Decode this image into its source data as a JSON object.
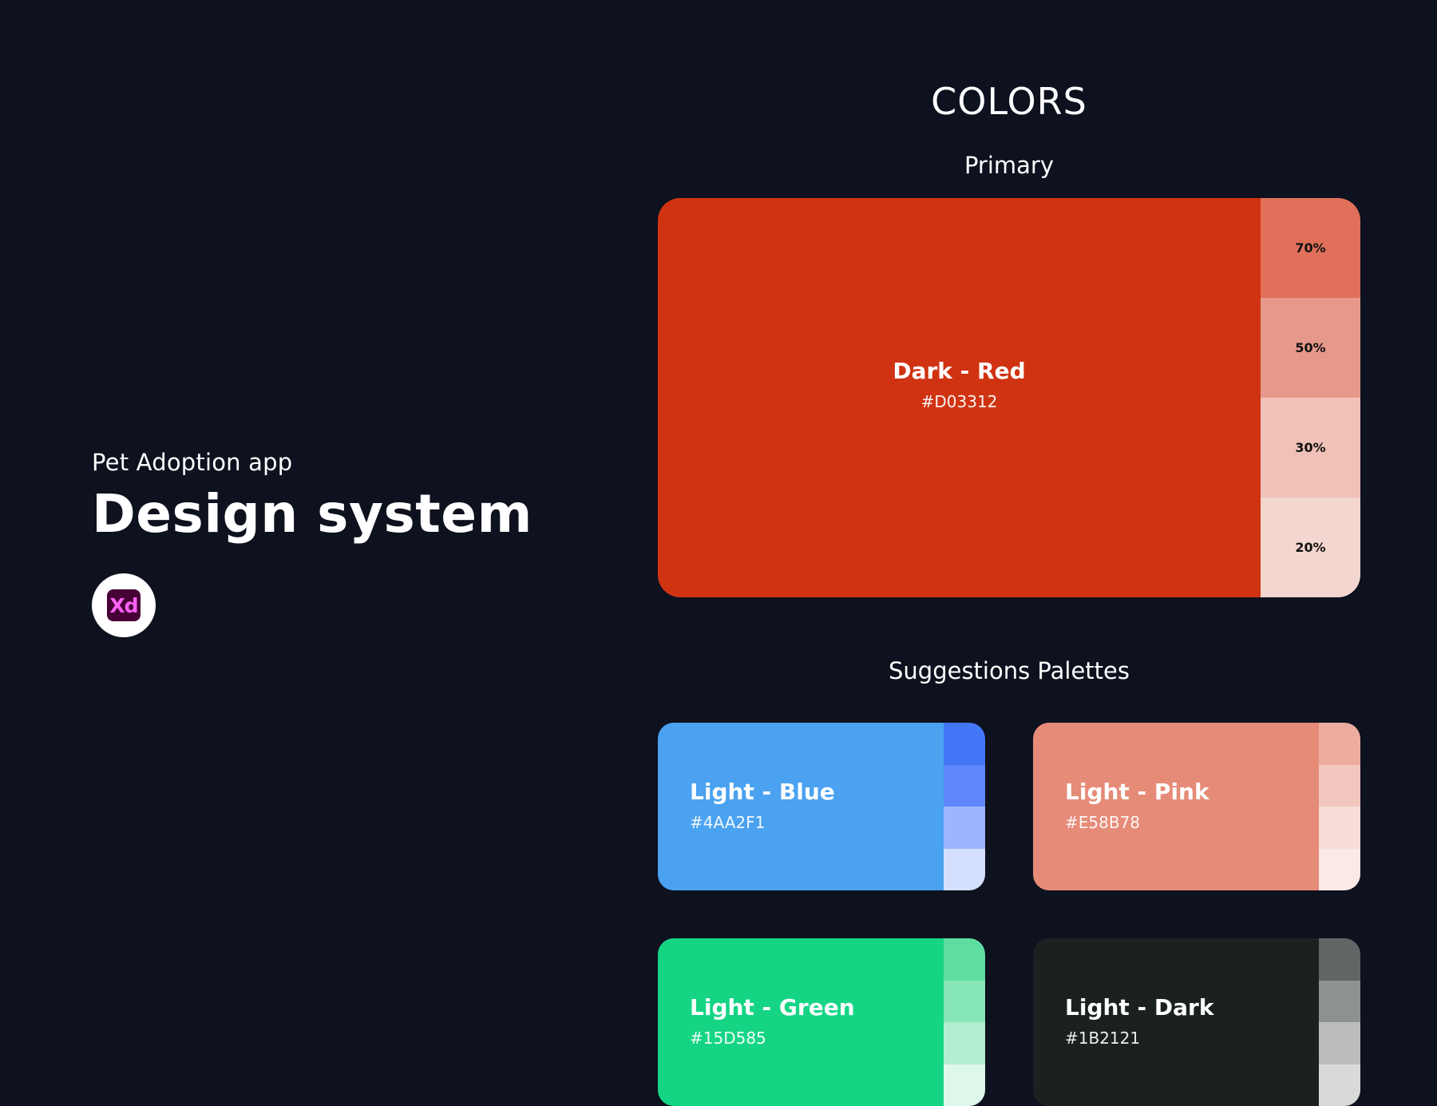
{
  "header": {
    "subtitle": "Pet Adoption app",
    "title": "Design system",
    "xd_logo_text": "Xd"
  },
  "sections": {
    "colors": "COLORS",
    "primary": "Primary",
    "suggestions": "Suggestions Palettes"
  },
  "primary": {
    "name": "Dark - Red",
    "hex": "#D03312",
    "color": "#D03312",
    "tints": [
      {
        "label": "70%",
        "color": "#E0705A"
      },
      {
        "label": "50%",
        "color": "#E6998A"
      },
      {
        "label": "30%",
        "color": "#EFC1B7"
      },
      {
        "label": "20%",
        "color": "#F3D6CF"
      }
    ]
  },
  "palettes": [
    {
      "name": "Light - Blue",
      "hex": "#4AA2F1",
      "color": "#4AA2F1",
      "shades": [
        "#4377F8",
        "#5E87FB",
        "#9CB5FD",
        "#D5E0FE"
      ]
    },
    {
      "name": "Light - Pink",
      "hex": "#E58B78",
      "color": "#E58B78",
      "shades": [
        "#EDACA0",
        "#F2C6BD",
        "#F7DDD7",
        "#FAE9E5"
      ]
    },
    {
      "name": "Light - Green",
      "hex": "#15D585",
      "color": "#15D585",
      "shades": [
        "#5DDD9F",
        "#87E6B7",
        "#B3EED1",
        "#DDF7EA"
      ]
    },
    {
      "name": "Light - Dark",
      "hex": "#1B2121",
      "color": "#1B2121",
      "shades": [
        "#616565",
        "#8E9191",
        "#BBBDBD",
        "#D8D9D9"
      ]
    }
  ],
  "colors": {
    "background": "#0E111E",
    "text": "#FFFFFF"
  }
}
